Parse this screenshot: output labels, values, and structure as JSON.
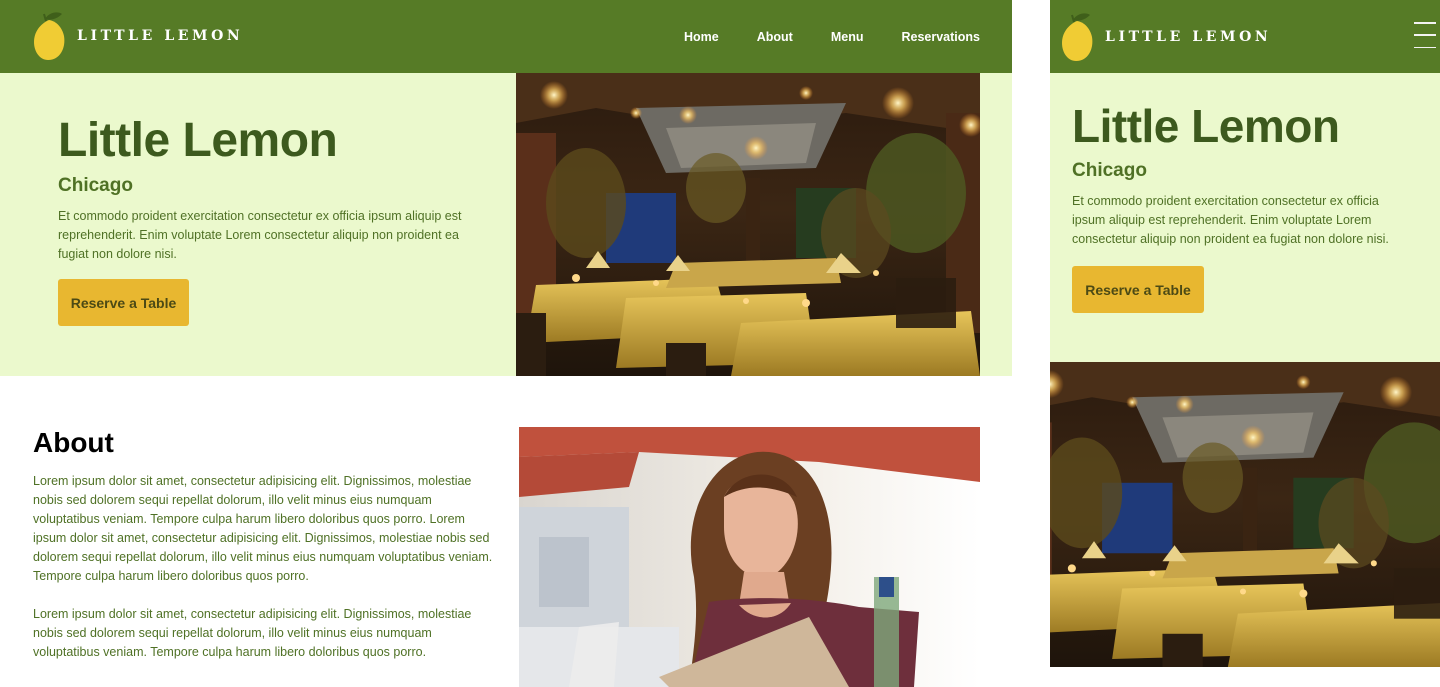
{
  "brand": {
    "name": "LITTLE LEMON"
  },
  "nav": {
    "items": [
      "Home",
      "About",
      "Menu",
      "Reservations"
    ]
  },
  "hero": {
    "title": "Little Lemon",
    "subtitle": "Chicago",
    "description": "Et commodo proident exercitation consectetur ex officia ipsum aliquip est reprehenderit. Enim voluptate Lorem consectetur aliquip non proident ea fugiat non dolore nisi.",
    "cta_label": "Reserve a Table"
  },
  "about": {
    "title": "About",
    "paragraphs": [
      "Lorem ipsum dolor sit amet, consectetur adipisicing elit. Dignissimos, molestiae nobis sed dolorem sequi repellat dolorum, illo velit minus eius numquam voluptatibus veniam. Tempore culpa harum libero doloribus quos porro. Lorem ipsum dolor sit amet, consectetur adipisicing elit. Dignissimos, molestiae nobis sed dolorem sequi repellat dolorum, illo velit minus eius numquam voluptatibus veniam. Tempore culpa harum libero doloribus quos porro.",
      "Lorem ipsum dolor sit amet, consectetur adipisicing elit. Dignissimos, molestiae nobis sed dolorem sequi repellat dolorum, illo velit minus eius numquam voluptatibus veniam. Tempore culpa harum libero doloribus quos porro."
    ]
  },
  "icons": {
    "logo": "lemon-icon",
    "menu": "hamburger-menu-icon"
  },
  "colors": {
    "header": "#567b26",
    "hero_background": "#ebf9cd",
    "title": "#3d5a1e",
    "body_text": "#4f7125",
    "button": "#e8b730",
    "button_text": "#4c4a15"
  }
}
